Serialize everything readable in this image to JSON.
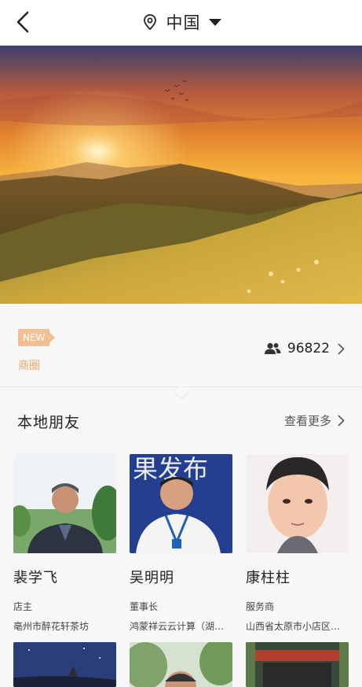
{
  "header": {
    "location": "中国"
  },
  "info": {
    "new_badge": "NEW",
    "circle_label": "商圈",
    "member_count": "96822"
  },
  "section": {
    "title": "本地朋友",
    "more_label": "查看更多"
  },
  "friends": [
    {
      "name": "裴学飞",
      "role": "店主",
      "shop": "亳州市醉花轩茶坊"
    },
    {
      "name": "吴明明",
      "role": "董事长",
      "shop": "鸿蒙祥云云计算（湖北）有限公司"
    },
    {
      "name": "康柱柱",
      "role": "服务商",
      "shop": "山西省太原市小店区…"
    }
  ],
  "photo_text": {
    "board": "果发布"
  },
  "colors": {
    "accent": "#e8a868",
    "badge": "#f2c08f"
  }
}
